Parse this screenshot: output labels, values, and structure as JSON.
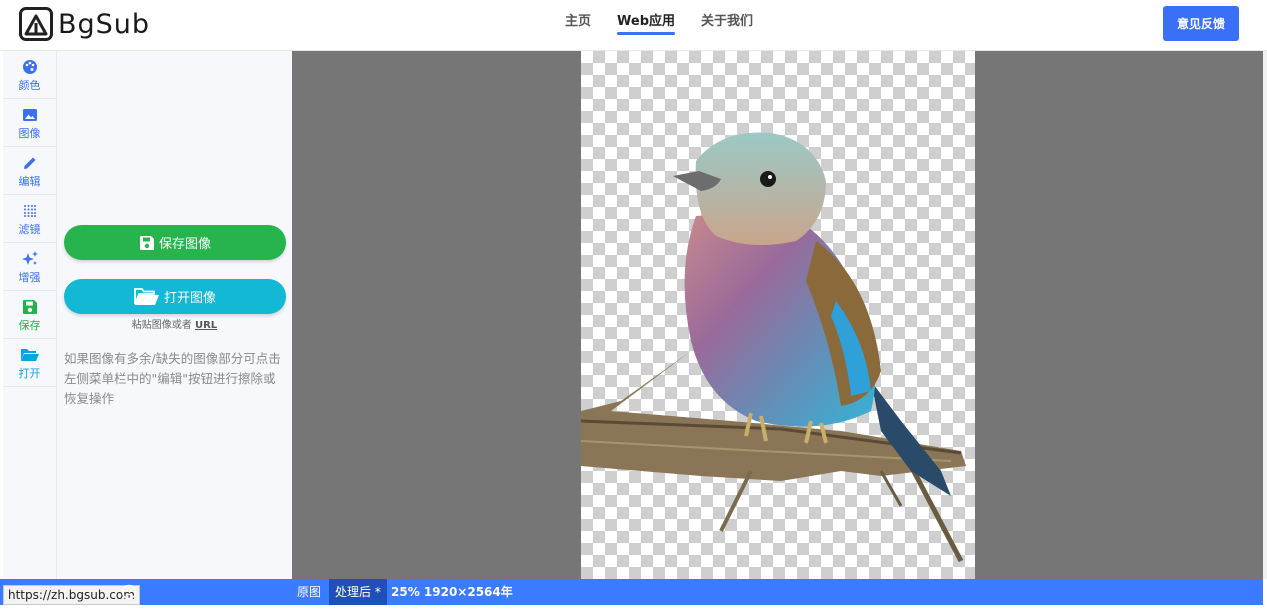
{
  "header": {
    "logo_text": "BgSub",
    "nav": [
      {
        "label": "主页",
        "active": false
      },
      {
        "label": "Web应用",
        "active": true
      },
      {
        "label": "关于我们",
        "active": false
      }
    ],
    "feedback_label": "意见反馈",
    "accent_color": "#3a6ff7"
  },
  "toolbar": {
    "items": [
      {
        "label": "颜色",
        "icon": "palette-icon"
      },
      {
        "label": "图像",
        "icon": "image-icon"
      },
      {
        "label": "编辑",
        "icon": "pencil-icon"
      },
      {
        "label": "滤镜",
        "icon": "filter-grid-icon"
      },
      {
        "label": "增强",
        "icon": "sparkle-icon"
      },
      {
        "label": "保存",
        "icon": "floppy-disk-icon"
      },
      {
        "label": "打开",
        "icon": "folder-open-icon"
      }
    ]
  },
  "panel": {
    "save_label": "保存图像",
    "open_label": "打开图像",
    "paste_prefix": "粘贴图像或者",
    "paste_link": "URL",
    "tip": "如果图像有多余/缺失的图像部分可点击左侧菜单栏中的\"编辑\"按钮进行擦除或恢复操作",
    "save_color": "#27b44c",
    "open_color": "#12b8d4"
  },
  "statusbar": {
    "url_hover": "https://zh.bgsub.com",
    "tab_original": "原图",
    "tab_processed": "处理后 *",
    "zoom_info": "25% 1920×2564年",
    "bar_color": "#3a7bff"
  }
}
